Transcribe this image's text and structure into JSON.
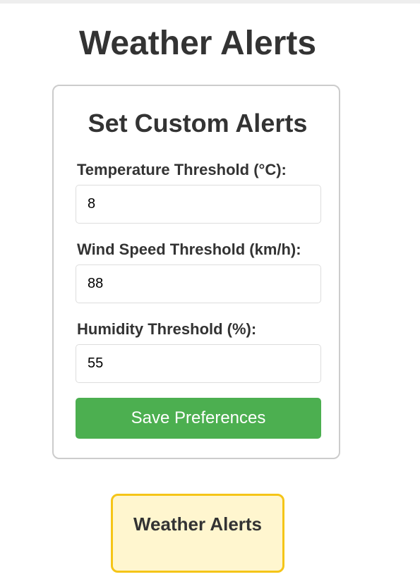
{
  "page": {
    "title": "Weather Alerts"
  },
  "settings_card": {
    "title": "Set Custom Alerts",
    "fields": [
      {
        "label": "Temperature Threshold (°C):",
        "value": "8"
      },
      {
        "label": "Wind Speed Threshold (km/h):",
        "value": "88"
      },
      {
        "label": "Humidity Threshold (%):",
        "value": "55"
      }
    ],
    "save_label": "Save Preferences"
  },
  "alerts_panel": {
    "title": "Weather Alerts"
  },
  "colors": {
    "button": "#4caf50",
    "alert_border": "#f5c518",
    "alert_background": "#fff6cf"
  }
}
